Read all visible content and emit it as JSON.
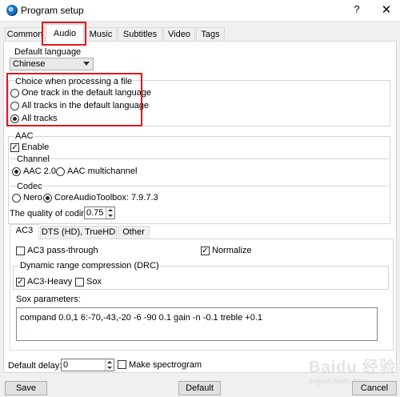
{
  "window": {
    "title": "Program setup",
    "help_label": "?",
    "close_label": "✕"
  },
  "tabs": [
    {
      "label": "Common",
      "active": false
    },
    {
      "label": "Audio",
      "active": true
    },
    {
      "label": "Music",
      "active": false
    },
    {
      "label": "Subtitles",
      "active": false
    },
    {
      "label": "Video",
      "active": false
    },
    {
      "label": "Tags",
      "active": false
    }
  ],
  "audio": {
    "default_language_label": "Default language",
    "default_language_value": "Chinese",
    "choice_group_label": "Choice when processing a file",
    "choice_options": [
      {
        "label": "One track in the default language",
        "selected": false
      },
      {
        "label": "All tracks in the default language",
        "selected": false
      },
      {
        "label": "All tracks",
        "selected": true
      }
    ],
    "aac_group_label": "AAC",
    "enable_label": "Enable",
    "enable_checked": true,
    "channel_label": "Channel",
    "channel_options": [
      {
        "label": "AAC 2.0",
        "selected": true
      },
      {
        "label": "AAC multichannel",
        "selected": false
      }
    ],
    "codec_label": "Codec",
    "codec_options": [
      {
        "label": "Nero",
        "selected": false
      },
      {
        "label": "CoreAudioToolbox: 7.9.7.3",
        "selected": true
      }
    ],
    "quality_label": "The quality of coding",
    "quality_value": "0.75",
    "subtabs": [
      {
        "label": "AC3",
        "active": true
      },
      {
        "label": "DTS (HD), TrueHD",
        "active": false
      },
      {
        "label": "Other",
        "active": false
      }
    ],
    "ac3": {
      "passthrough_label": "AC3 pass-through",
      "passthrough_checked": false,
      "normalize_label": "Normalize",
      "normalize_checked": true,
      "drc_label": "Dynamic range compression (DRC)",
      "ac3_heavy_label": "AC3-Heavy",
      "ac3_heavy_checked": true,
      "sox_label": "Sox",
      "sox_checked": false,
      "sox_params_label": "Sox parameters:",
      "sox_params_value": "compand 0.0,1 6:-70,-43,-20 -6 -90 0.1 gain -n -0.1 treble +0.1"
    },
    "default_delay_label": "Default delay:",
    "default_delay_value": "0",
    "spectrogram_label": "Make spectrogram",
    "spectrogram_checked": false
  },
  "buttons": {
    "save": "Save",
    "default": "Default",
    "cancel": "Cancel"
  },
  "watermark": {
    "text": "Baidu 经验",
    "sub": "jingyan.baidu.com"
  },
  "colors": {
    "highlight_box": "#e0181f",
    "dialog_bg": "#f0f0f0",
    "panel_bg": "#ffffff"
  },
  "icons": {
    "app": "program-globe-icon",
    "help": "question-mark-icon",
    "close": "close-icon",
    "dropdown": "chevron-down-icon",
    "spin": "spin-arrows-icon"
  }
}
